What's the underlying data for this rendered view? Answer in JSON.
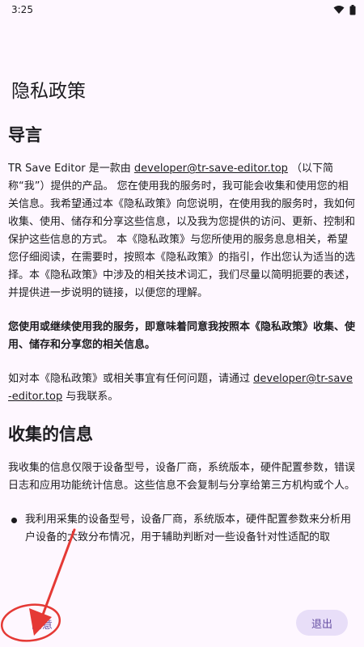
{
  "status_bar": {
    "time": "3:25",
    "icons": [
      "wifi-icon",
      "battery-icon"
    ]
  },
  "page": {
    "title": "隐私政策"
  },
  "sections": {
    "intro": {
      "title": "导言",
      "p1_before": "TR Save Editor 是一款由 ",
      "p1_email": "developer@tr-save-editor.top",
      "p1_after": " （以下简称“我”）提供的产品。 您在使用我的服务时，我可能会收集和使用您的相关信息。我希望通过本《隐私政策》向您说明，在使用我的服务时，我如何收集、使用、储存和分享这些信息，以及我为您提供的访问、更新、控制和保护这些信息的方式。 本《隐私政策》与您所使用的服务息息相关，希望您仔细阅读，在需要时，按照本《隐私政策》的指引，作出您认为适当的选择。本《隐私政策》中涉及的相关技术词汇，我们尽量以简明扼要的表述，并提供进一步说明的链接，以便您的理解。",
      "p2": "您使用或继续使用我的服务，即意味着同意我按照本《隐私政策》收集、使用、储存和分享您的相关信息。",
      "p3_before": "如对本《隐私政策》或相关事宜有任何问题，请通过 ",
      "p3_email": "developer@tr-save-editor.top",
      "p3_after": " 与我联系。"
    },
    "collect": {
      "title": "收集的信息",
      "p1": "我收集的信息仅限于设备型号，设备厂商，系统版本，硬件配置参数，错误日志和应用功能统计信息。这些信息不会复制与分享给第三方机构或个人。",
      "bullet1": "我利用采集的设备型号，设备厂商，系统版本，硬件配置参数来分析用户设备的大致分布情况，用于辅助判断对一些设备针对性适配的取"
    }
  },
  "actions": {
    "agree_label": "同意",
    "exit_label": "退出"
  },
  "colors": {
    "background": "#FEF7FF",
    "primary": "#6750A4",
    "tonal_button": "#E8DEF8",
    "annotation_red": "#E53935"
  }
}
